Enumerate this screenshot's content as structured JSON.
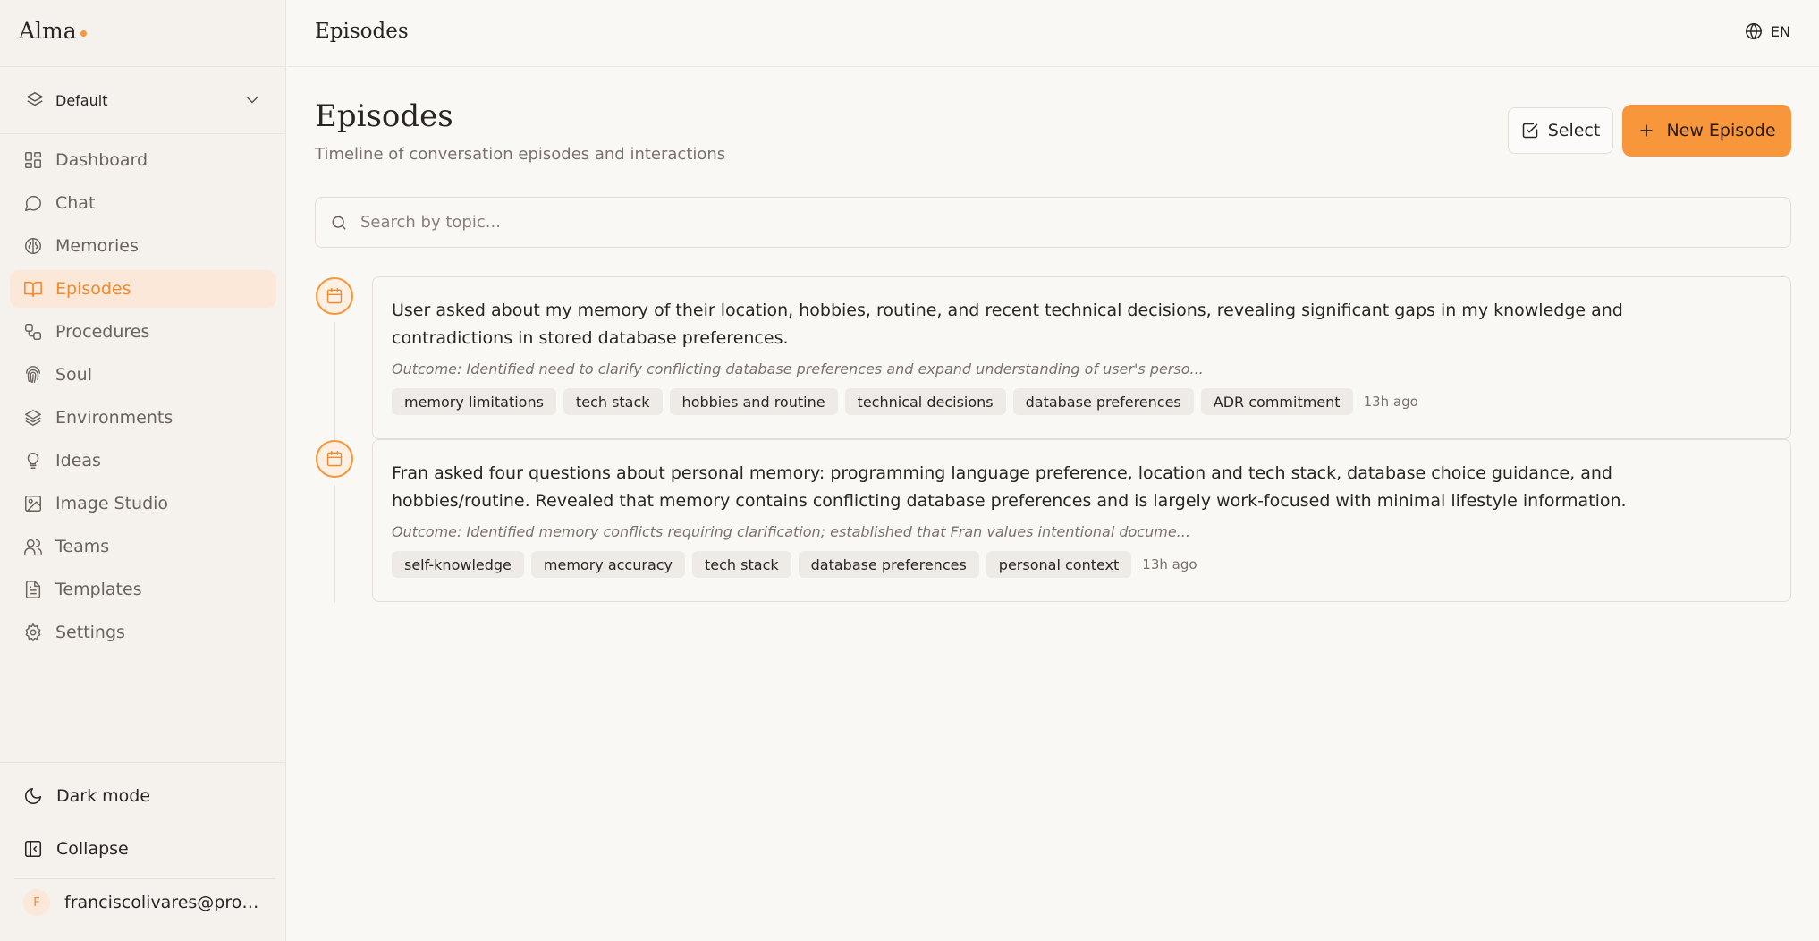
{
  "app": {
    "name": "Alma",
    "accent": "#f7963a"
  },
  "environment": {
    "label": "Default"
  },
  "sidebar": {
    "items": [
      {
        "label": "Dashboard",
        "icon": "dashboard-icon"
      },
      {
        "label": "Chat",
        "icon": "chat-icon"
      },
      {
        "label": "Memories",
        "icon": "brain-icon"
      },
      {
        "label": "Episodes",
        "icon": "book-icon",
        "active": true
      },
      {
        "label": "Procedures",
        "icon": "workflow-icon"
      },
      {
        "label": "Soul",
        "icon": "fingerprint-icon"
      },
      {
        "label": "Environments",
        "icon": "layers-icon"
      },
      {
        "label": "Ideas",
        "icon": "lightbulb-icon"
      },
      {
        "label": "Image Studio",
        "icon": "image-icon"
      },
      {
        "label": "Teams",
        "icon": "users-icon"
      },
      {
        "label": "Templates",
        "icon": "file-text-icon"
      },
      {
        "label": "Settings",
        "icon": "gear-icon"
      }
    ],
    "dark_mode_label": "Dark mode",
    "collapse_label": "Collapse",
    "user": {
      "initial": "F",
      "email": "franciscolivares@proto..."
    }
  },
  "topbar": {
    "title": "Episodes",
    "language": "EN"
  },
  "main": {
    "title": "Episodes",
    "subtitle": "Timeline of conversation episodes and interactions",
    "select_label": "Select",
    "new_label": "New Episode",
    "search_placeholder": "Search by topic...",
    "episodes": [
      {
        "summary": "User asked about my memory of their location, hobbies, routine, and recent technical decisions, revealing significant gaps in my knowledge and contradictions in stored database preferences.",
        "outcome": "Outcome: Identified need to clarify conflicting database preferences and expand understanding of user's perso...",
        "tags": [
          "memory limitations",
          "tech stack",
          "hobbies and routine",
          "technical decisions",
          "database preferences",
          "ADR commitment"
        ],
        "time": "13h ago"
      },
      {
        "summary": "Fran asked four questions about personal memory: programming language preference, location and tech stack, database choice guidance, and hobbies/routine. Revealed that memory contains conflicting database preferences and is largely work-focused with minimal lifestyle information.",
        "outcome": "Outcome: Identified memory conflicts requiring clarification; established that Fran values intentional docume...",
        "tags": [
          "self-knowledge",
          "memory accuracy",
          "tech stack",
          "database preferences",
          "personal context"
        ],
        "time": "13h ago"
      }
    ]
  }
}
